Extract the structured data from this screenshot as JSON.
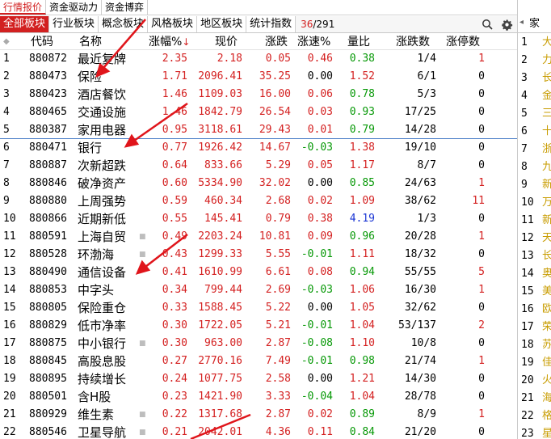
{
  "top_tabs": [
    {
      "label": "行情报价",
      "active": true
    },
    {
      "label": "资金驱动力",
      "active": false
    },
    {
      "label": "资金博弈",
      "active": false
    }
  ],
  "section_tabs": [
    {
      "label": "全部板块",
      "active": true
    },
    {
      "label": "行业板块",
      "active": false
    },
    {
      "label": "概念板块",
      "active": false
    },
    {
      "label": "风格板块",
      "active": false
    },
    {
      "label": "地区板块",
      "active": false
    },
    {
      "label": "统计指数",
      "active": false
    }
  ],
  "pager": {
    "current": "36",
    "separator": "/",
    "total": "291"
  },
  "icons": {
    "search": "search-icon",
    "settings": "gear-icon"
  },
  "columns": {
    "code": "代码",
    "name": "名称",
    "pct": "涨幅%",
    "pct_sort": "↓",
    "price": "现价",
    "change": "涨跌",
    "speed": "涨速%",
    "volume_ratio": "量比",
    "up_down": "涨跌数",
    "limit_up": "涨停数"
  },
  "rows": [
    {
      "idx": "1",
      "code": "880872",
      "name": "最近复牌",
      "mark": false,
      "pct": "2.35",
      "price": "2.18",
      "change": "0.05",
      "speed": "0.46",
      "vr": "0.38",
      "ud": "1/4",
      "limit": "1"
    },
    {
      "idx": "2",
      "code": "880473",
      "name": "保险",
      "mark": false,
      "pct": "1.71",
      "price": "2096.41",
      "change": "35.25",
      "speed": "0.00",
      "vr": "1.52",
      "ud": "6/1",
      "limit": "0"
    },
    {
      "idx": "3",
      "code": "880423",
      "name": "酒店餐饮",
      "mark": false,
      "pct": "1.46",
      "price": "1109.03",
      "change": "16.00",
      "speed": "0.06",
      "vr": "0.78",
      "ud": "5/3",
      "limit": "0"
    },
    {
      "idx": "4",
      "code": "880465",
      "name": "交通设施",
      "mark": false,
      "pct": "1.46",
      "price": "1842.79",
      "change": "26.54",
      "speed": "0.03",
      "vr": "0.93",
      "ud": "17/25",
      "limit": "0"
    },
    {
      "idx": "5",
      "code": "880387",
      "name": "家用电器",
      "mark": false,
      "pct": "0.95",
      "price": "3118.61",
      "change": "29.43",
      "speed": "0.01",
      "vr": "0.79",
      "ud": "14/28",
      "limit": "0"
    },
    {
      "idx": "6",
      "code": "880471",
      "name": "银行",
      "mark": false,
      "pct": "0.77",
      "price": "1926.42",
      "change": "14.67",
      "speed": "-0.03",
      "vr": "1.38",
      "ud": "19/10",
      "limit": "0"
    },
    {
      "idx": "7",
      "code": "880887",
      "name": "次新超跌",
      "mark": false,
      "pct": "0.64",
      "price": "833.66",
      "change": "5.29",
      "speed": "0.05",
      "vr": "1.17",
      "ud": "8/7",
      "limit": "0"
    },
    {
      "idx": "8",
      "code": "880846",
      "name": "破净资产",
      "mark": false,
      "pct": "0.60",
      "price": "5334.90",
      "change": "32.02",
      "speed": "0.00",
      "vr": "0.85",
      "ud": "24/63",
      "limit": "1"
    },
    {
      "idx": "9",
      "code": "880880",
      "name": "上周强势",
      "mark": false,
      "pct": "0.59",
      "price": "460.34",
      "change": "2.68",
      "speed": "0.02",
      "vr": "1.09",
      "ud": "38/62",
      "limit": "11"
    },
    {
      "idx": "10",
      "code": "880866",
      "name": "近期新低",
      "mark": false,
      "pct": "0.55",
      "price": "145.41",
      "change": "0.79",
      "speed": "0.38",
      "vr": "4.19",
      "ud": "1/3",
      "limit": "0"
    },
    {
      "idx": "11",
      "code": "880591",
      "name": "上海自贸",
      "mark": true,
      "pct": "0.49",
      "price": "2203.24",
      "change": "10.81",
      "speed": "0.09",
      "vr": "0.96",
      "ud": "20/28",
      "limit": "1"
    },
    {
      "idx": "12",
      "code": "880528",
      "name": "环渤海",
      "mark": true,
      "pct": "0.43",
      "price": "1299.33",
      "change": "5.55",
      "speed": "-0.01",
      "vr": "1.11",
      "ud": "18/32",
      "limit": "0"
    },
    {
      "idx": "13",
      "code": "880490",
      "name": "通信设备",
      "mark": false,
      "pct": "0.41",
      "price": "1610.99",
      "change": "6.61",
      "speed": "0.08",
      "vr": "0.94",
      "ud": "55/55",
      "limit": "5"
    },
    {
      "idx": "14",
      "code": "880853",
      "name": "中字头",
      "mark": false,
      "pct": "0.34",
      "price": "799.44",
      "change": "2.69",
      "speed": "-0.03",
      "vr": "1.06",
      "ud": "16/30",
      "limit": "1"
    },
    {
      "idx": "15",
      "code": "880805",
      "name": "保险重仓",
      "mark": false,
      "pct": "0.33",
      "price": "1588.45",
      "change": "5.22",
      "speed": "0.00",
      "vr": "1.05",
      "ud": "32/62",
      "limit": "0"
    },
    {
      "idx": "16",
      "code": "880829",
      "name": "低市净率",
      "mark": false,
      "pct": "0.30",
      "price": "1722.05",
      "change": "5.21",
      "speed": "-0.01",
      "vr": "1.04",
      "ud": "53/137",
      "limit": "2"
    },
    {
      "idx": "17",
      "code": "880875",
      "name": "中小银行",
      "mark": true,
      "pct": "0.30",
      "price": "963.00",
      "change": "2.87",
      "speed": "-0.08",
      "vr": "1.10",
      "ud": "10/8",
      "limit": "0"
    },
    {
      "idx": "18",
      "code": "880845",
      "name": "高股息股",
      "mark": false,
      "pct": "0.27",
      "price": "2770.16",
      "change": "7.49",
      "speed": "-0.01",
      "vr": "0.98",
      "ud": "21/74",
      "limit": "1"
    },
    {
      "idx": "19",
      "code": "880895",
      "name": "持续增长",
      "mark": false,
      "pct": "0.24",
      "price": "1077.75",
      "change": "2.58",
      "speed": "0.00",
      "vr": "1.21",
      "ud": "14/30",
      "limit": "0"
    },
    {
      "idx": "20",
      "code": "880501",
      "name": "含H股",
      "mark": false,
      "pct": "0.23",
      "price": "1421.90",
      "change": "3.33",
      "speed": "-0.04",
      "vr": "1.04",
      "ud": "28/78",
      "limit": "0"
    },
    {
      "idx": "21",
      "code": "880929",
      "name": "维生素",
      "mark": true,
      "pct": "0.22",
      "price": "1317.68",
      "change": "2.87",
      "speed": "0.02",
      "vr": "0.89",
      "ud": "8/9",
      "limit": "1"
    },
    {
      "idx": "22",
      "code": "880546",
      "name": "卫星导航",
      "mark": true,
      "pct": "0.21",
      "price": "2042.01",
      "change": "4.36",
      "speed": "0.11",
      "vr": "0.84",
      "ud": "21/20",
      "limit": "0"
    }
  ],
  "right_panel": {
    "header": "家",
    "rows": [
      {
        "idx": "1",
        "frag": "大"
      },
      {
        "idx": "2",
        "frag": "力"
      },
      {
        "idx": "3",
        "frag": "长"
      },
      {
        "idx": "4",
        "frag": "金"
      },
      {
        "idx": "5",
        "frag": "三"
      },
      {
        "idx": "6",
        "frag": "十"
      },
      {
        "idx": "7",
        "frag": "浙"
      },
      {
        "idx": "8",
        "frag": "九"
      },
      {
        "idx": "9",
        "frag": "新"
      },
      {
        "idx": "10",
        "frag": "万"
      },
      {
        "idx": "11",
        "frag": "新"
      },
      {
        "idx": "12",
        "frag": "天"
      },
      {
        "idx": "13",
        "frag": "长"
      },
      {
        "idx": "14",
        "frag": "奥"
      },
      {
        "idx": "15",
        "frag": "美"
      },
      {
        "idx": "16",
        "frag": "欧"
      },
      {
        "idx": "17",
        "frag": "荣"
      },
      {
        "idx": "18",
        "frag": "苏"
      },
      {
        "idx": "19",
        "frag": "佳"
      },
      {
        "idx": "20",
        "frag": "火"
      },
      {
        "idx": "21",
        "frag": "海"
      },
      {
        "idx": "22",
        "frag": "格"
      },
      {
        "idx": "23",
        "frag": "星"
      }
    ]
  },
  "colors": {
    "up": "#d42121",
    "down": "#089908",
    "active_tab": "#d22020",
    "highlight_vr": "#1a35d4",
    "separator": "#4a7ec7",
    "annotation_arrow": "#e0151b"
  }
}
